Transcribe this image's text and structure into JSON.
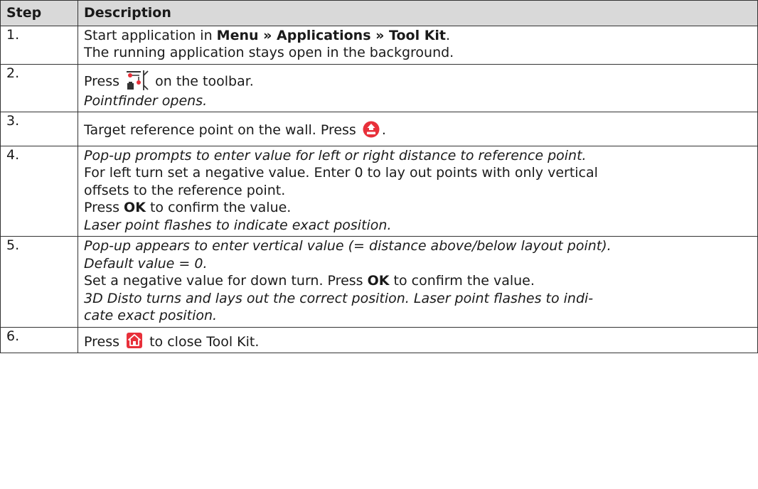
{
  "header": {
    "step": "Step",
    "description": "Description"
  },
  "rows": [
    {
      "num": "1.",
      "l1_pre": "Start application in ",
      "l1_bold": "Menu » Applications » Tool Kit",
      "l1_post": ".",
      "l2": "The running application stays open in the background."
    },
    {
      "num": "2.",
      "press": "Press",
      "post": "on the toolbar.",
      "result": "Pointfinder opens."
    },
    {
      "num": "3.",
      "text": "Target reference point on the wall. Press",
      "post": "."
    },
    {
      "num": "4.",
      "result1": "Pop-up prompts to enter value for left or right distance to reference point.",
      "text1": "For left turn set a negative value. Enter 0 to lay out points with only vertical",
      "text2": "offsets to the reference point.",
      "ok_pre": "Press ",
      "ok": "OK",
      "ok_post": " to confirm the value.",
      "result2": "Laser point flashes to indicate exact position."
    },
    {
      "num": "5.",
      "r1": "Pop-up appears to enter vertical value (= distance above/below layout point).",
      "r2": "Default value = 0.",
      "t1_pre": "Set a negative value for down turn. Press ",
      "ok": "OK",
      "t1_post": " to confirm the value.",
      "r3": "3D Disto turns and lays out the correct position. Laser point flashes to indi-",
      "r4": "cate exact position."
    },
    {
      "num": "6.",
      "press": "Press",
      "post": "to close Tool Kit."
    }
  ],
  "icons": {
    "toolbar_pointfinder": "pointfinder-toolbar-icon",
    "dist_key": "dist-key-icon",
    "home_key": "home-key-icon",
    "accent_red": "#e8303a"
  }
}
